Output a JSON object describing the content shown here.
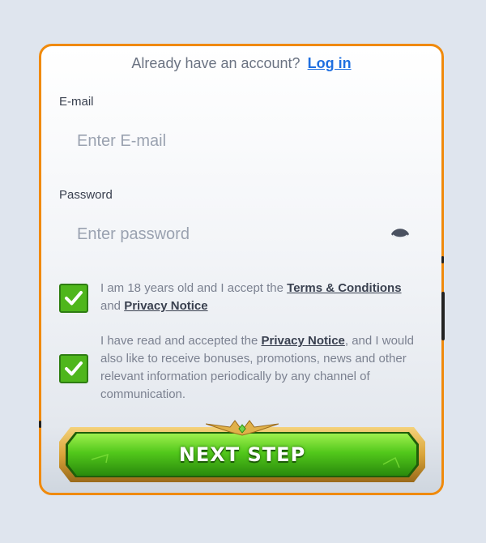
{
  "header": {
    "prompt_text": "Already have an account?",
    "login_link": "Log in"
  },
  "email": {
    "label": "E-mail",
    "placeholder": "Enter E-mail",
    "value": ""
  },
  "password": {
    "label": "Password",
    "placeholder": "Enter password",
    "value": ""
  },
  "consents": [
    {
      "checked": true,
      "text_before": "I am 18 years old and I accept the",
      "link1": "Terms & Conditions",
      "text_middle": "and",
      "link2": "Privacy Notice"
    },
    {
      "checked": true,
      "text_before": "I have read and accepted the",
      "link": "Privacy Notice",
      "text_after": ", and I would also like to receive bonuses, promotions, news and other relevant information periodically by any channel of communication."
    }
  ],
  "next_button": {
    "label": "NEXT STEP"
  },
  "colors": {
    "page_bg": "#dfe5ee",
    "card_border": "#f08a0c",
    "link_blue": "#1f6fe0",
    "checkbox_green": "#4fb61c",
    "button_green": "#52c81b",
    "button_gold": "#d9a43a"
  },
  "icons": {
    "password_toggle": "eye-icon",
    "checkbox_mark": "checkmark-icon",
    "button_crest": "gold-crest-icon"
  }
}
